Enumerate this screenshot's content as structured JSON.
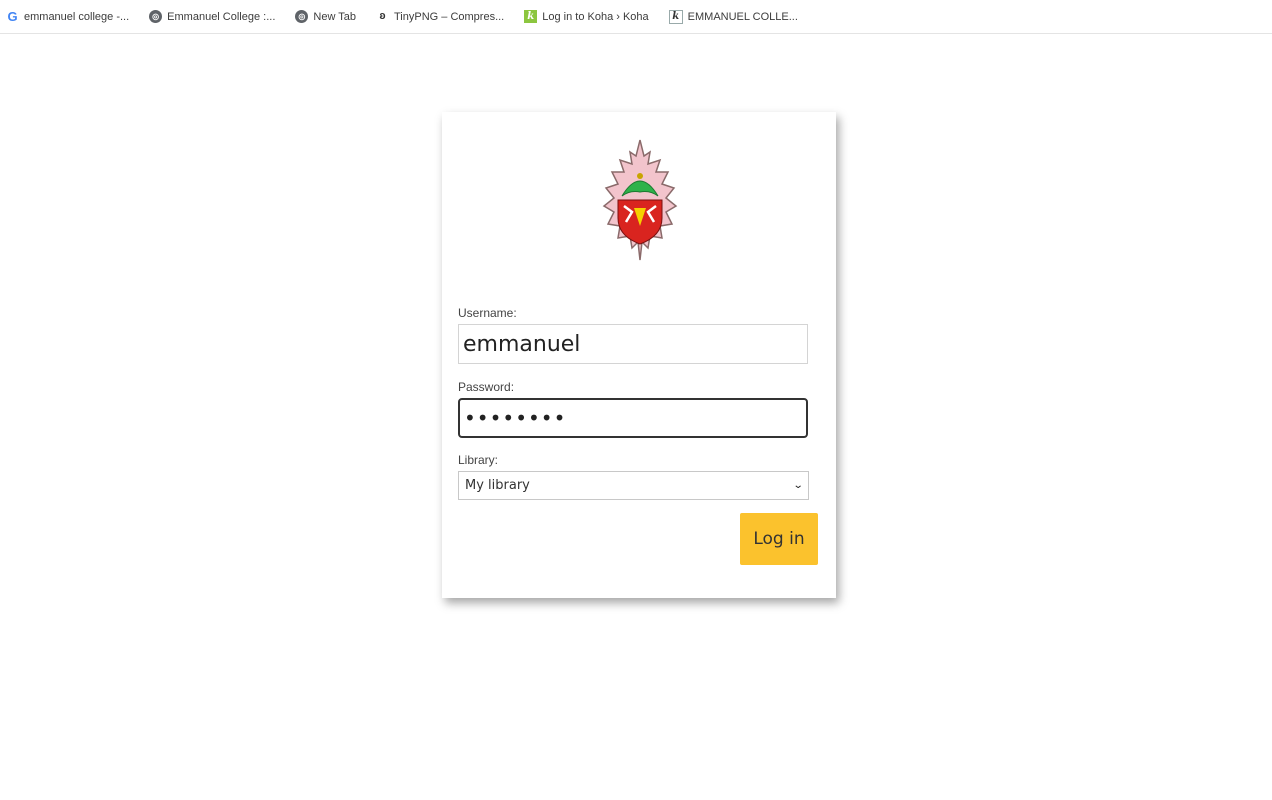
{
  "bookmarks": [
    {
      "icon": "google-icon",
      "label": "emmanuel college -..."
    },
    {
      "icon": "globe-icon",
      "label": "Emmanuel College :..."
    },
    {
      "icon": "globe-icon",
      "label": "New Tab"
    },
    {
      "icon": "panda-icon",
      "label": "TinyPNG – Compres..."
    },
    {
      "icon": "koha-icon",
      "label": "Log in to Koha › Koha"
    },
    {
      "icon": "koha-icon",
      "label": "EMMANUEL COLLE..."
    }
  ],
  "login": {
    "username_label": "Username:",
    "username_value": "emmanuel",
    "password_label": "Password:",
    "password_value": "••••••••",
    "library_label": "Library:",
    "library_selected": "My library",
    "submit_label": "Log in"
  },
  "colors": {
    "button_bg": "#fbc22d",
    "logo_shield_red": "#d9241f",
    "logo_crown_green": "#2eb24a",
    "logo_bg_pink": "#f2c4cc"
  }
}
